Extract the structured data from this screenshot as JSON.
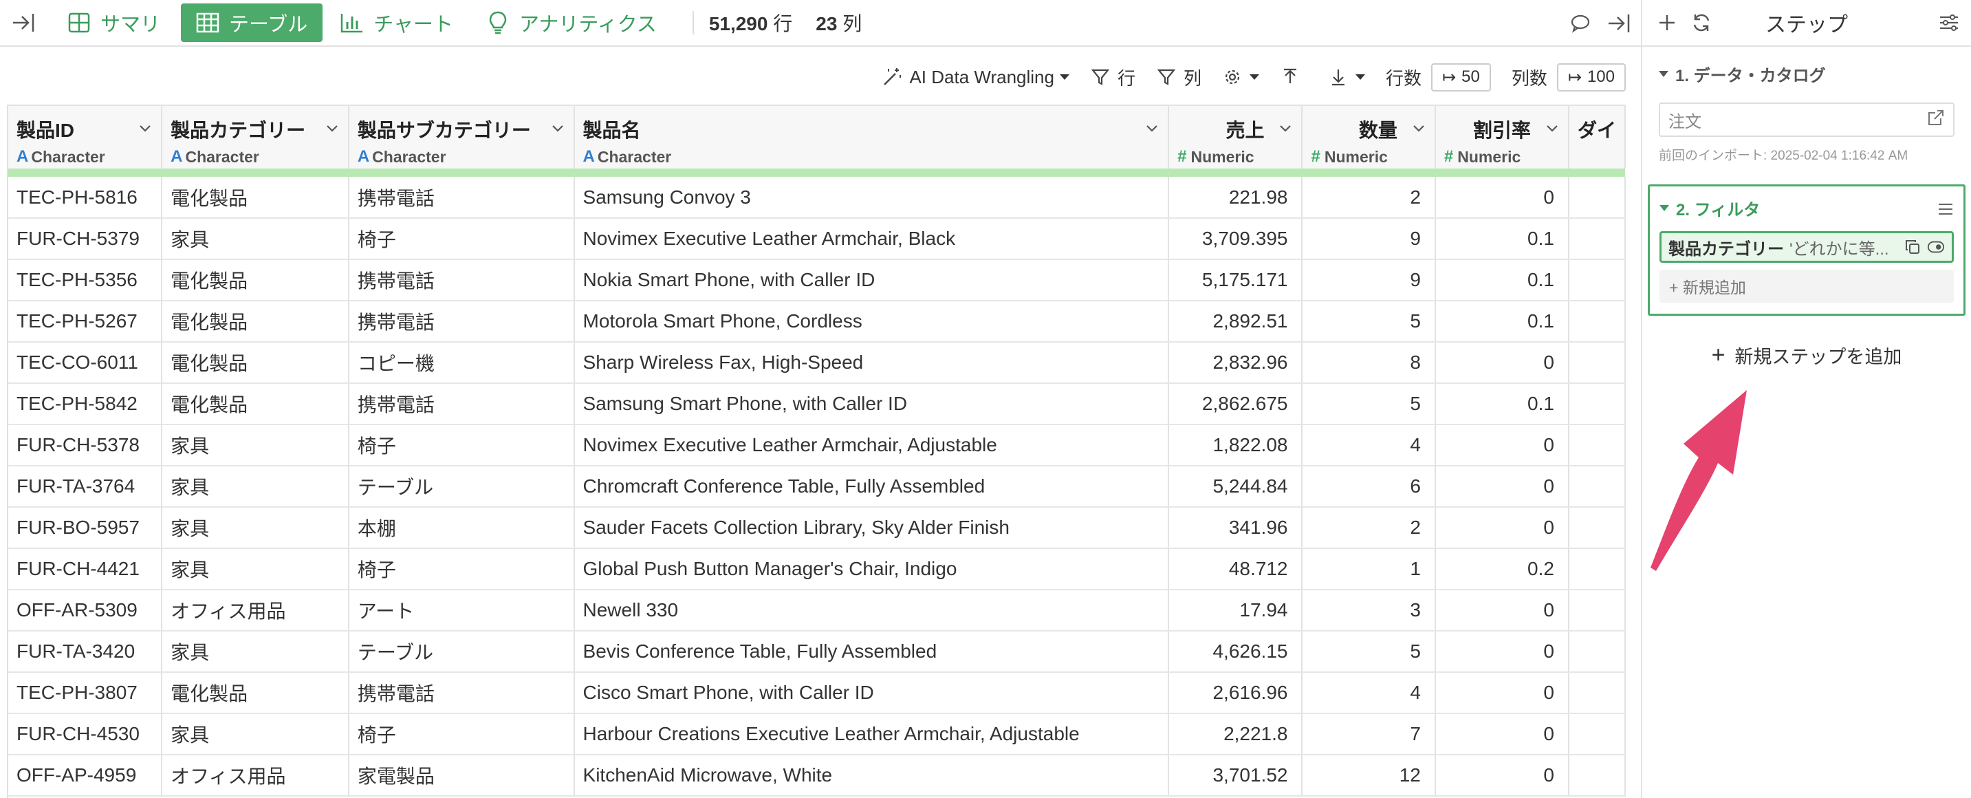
{
  "topbar": {
    "tabs": [
      {
        "label": "サマリ",
        "icon": "summary-grid-icon",
        "active": false
      },
      {
        "label": "テーブル",
        "icon": "table-icon",
        "active": true
      },
      {
        "label": "チャート",
        "icon": "bar-chart-icon",
        "active": false
      },
      {
        "label": "アナリティクス",
        "icon": "lightbulb-icon",
        "active": false
      }
    ],
    "rows_count": "51,290",
    "rows_unit": "行",
    "cols_count": "23",
    "cols_unit": "列"
  },
  "toolbar": {
    "ai_label": "AI Data Wrangling",
    "row_filter": "行",
    "col_filter": "列",
    "rows_label": "行数",
    "rows_value": "50",
    "cols_label": "列数",
    "cols_value": "100"
  },
  "table": {
    "columns": [
      {
        "name": "製品ID",
        "type": "Character",
        "kind": "char"
      },
      {
        "name": "製品カテゴリー",
        "type": "Character",
        "kind": "char"
      },
      {
        "name": "製品サブカテゴリー",
        "type": "Character",
        "kind": "char"
      },
      {
        "name": "製品名",
        "type": "Character",
        "kind": "char"
      },
      {
        "name": "売上",
        "type": "Numeric",
        "kind": "num"
      },
      {
        "name": "数量",
        "type": "Numeric",
        "kind": "num"
      },
      {
        "name": "割引率",
        "type": "Numeric",
        "kind": "num"
      },
      {
        "name": "ダイ",
        "type": "",
        "kind": "char"
      }
    ],
    "rows": [
      [
        "TEC-PH-5816",
        "電化製品",
        "携帯電話",
        "Samsung Convoy 3",
        "221.98",
        "2",
        "0",
        ""
      ],
      [
        "FUR-CH-5379",
        "家具",
        "椅子",
        "Novimex Executive Leather Armchair, Black",
        "3,709.395",
        "9",
        "0.1",
        ""
      ],
      [
        "TEC-PH-5356",
        "電化製品",
        "携帯電話",
        "Nokia Smart Phone, with Caller ID",
        "5,175.171",
        "9",
        "0.1",
        ""
      ],
      [
        "TEC-PH-5267",
        "電化製品",
        "携帯電話",
        "Motorola Smart Phone, Cordless",
        "2,892.51",
        "5",
        "0.1",
        ""
      ],
      [
        "TEC-CO-6011",
        "電化製品",
        "コピー機",
        "Sharp Wireless Fax, High-Speed",
        "2,832.96",
        "8",
        "0",
        ""
      ],
      [
        "TEC-PH-5842",
        "電化製品",
        "携帯電話",
        "Samsung Smart Phone, with Caller ID",
        "2,862.675",
        "5",
        "0.1",
        ""
      ],
      [
        "FUR-CH-5378",
        "家具",
        "椅子",
        "Novimex Executive Leather Armchair, Adjustable",
        "1,822.08",
        "4",
        "0",
        ""
      ],
      [
        "FUR-TA-3764",
        "家具",
        "テーブル",
        "Chromcraft Conference Table, Fully Assembled",
        "5,244.84",
        "6",
        "0",
        ""
      ],
      [
        "FUR-BO-5957",
        "家具",
        "本棚",
        "Sauder Facets Collection Library, Sky Alder Finish",
        "341.96",
        "2",
        "0",
        ""
      ],
      [
        "FUR-CH-4421",
        "家具",
        "椅子",
        "Global Push Button Manager's Chair, Indigo",
        "48.712",
        "1",
        "0.2",
        ""
      ],
      [
        "OFF-AR-5309",
        "オフィス用品",
        "アート",
        "Newell 330",
        "17.94",
        "3",
        "0",
        ""
      ],
      [
        "FUR-TA-3420",
        "家具",
        "テーブル",
        "Bevis Conference Table, Fully Assembled",
        "4,626.15",
        "5",
        "0",
        ""
      ],
      [
        "TEC-PH-3807",
        "電化製品",
        "携帯電話",
        "Cisco Smart Phone, with Caller ID",
        "2,616.96",
        "4",
        "0",
        ""
      ],
      [
        "FUR-CH-4530",
        "家具",
        "椅子",
        "Harbour Creations Executive Leather Armchair, Adjustable",
        "2,221.8",
        "7",
        "0",
        ""
      ],
      [
        "OFF-AP-4959",
        "オフィス用品",
        "家電製品",
        "KitchenAid Microwave, White",
        "3,701.52",
        "12",
        "0",
        ""
      ]
    ]
  },
  "steps": {
    "title": "ステップ",
    "step1": {
      "label": "1. データ・カタログ",
      "source": "注文",
      "import_info": "前回のインポート: 2025-02-04 1:16:42 AM"
    },
    "step2": {
      "label": "2. フィルタ",
      "chip_column": "製品カテゴリー",
      "chip_value": "'どれかに等...",
      "add_new": "+ 新規追加"
    },
    "add_step": "新規ステップを追加"
  },
  "colors": {
    "accent_green": "#4caa6a",
    "arrow_pink": "#e6426e",
    "type_char": "#2f7fd1",
    "type_num": "#3aaa64"
  }
}
